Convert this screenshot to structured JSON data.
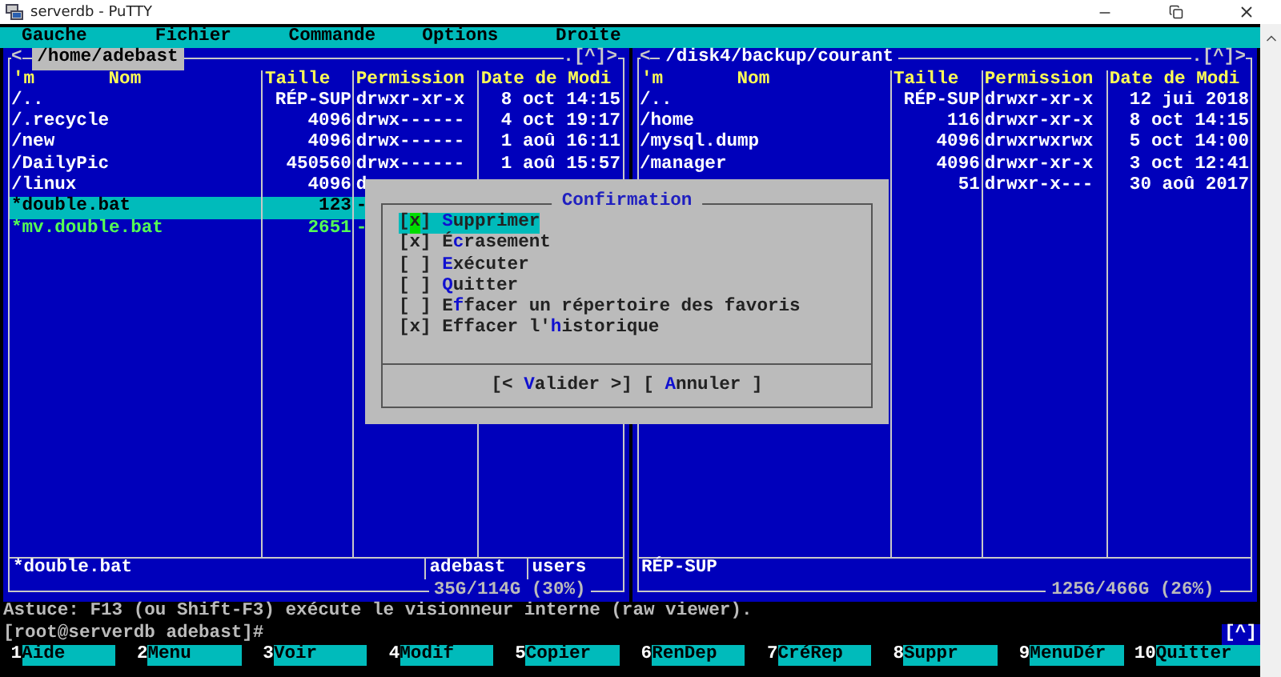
{
  "window": {
    "title": "serverdb - PuTTY"
  },
  "menu": [
    "Gauche",
    "Fichier",
    "Commande",
    "Options",
    "Droite"
  ],
  "panels": [
    {
      "active": true,
      "nav_left": "<",
      "path": "/home/adebast",
      "nav_right": ".[^]>",
      "sort_mark": "'m",
      "columns": [
        "Nom",
        "Taille",
        "Permission",
        "Date de Modi"
      ],
      "rows": [
        {
          "name": "/..",
          "size": "RÉP-SUP",
          "permission": "drwxr-xr-x",
          "date": "8 oct 14:15",
          "kind": "dir",
          "selected": false
        },
        {
          "name": "/.recycle",
          "size": "4096",
          "permission": "drwx------",
          "date": "4 oct 19:17",
          "kind": "dir",
          "selected": false
        },
        {
          "name": "/new",
          "size": "4096",
          "permission": "drwx------",
          "date": "1 aoû 16:11",
          "kind": "dir",
          "selected": false
        },
        {
          "name": "/DailyPic",
          "size": "450560",
          "permission": "drwx------",
          "date": "1 aoû 15:57",
          "kind": "dir",
          "selected": false
        },
        {
          "name": "/linux",
          "size": "4096",
          "permission": "d",
          "kind": "dir",
          "selected": false
        },
        {
          "name": "*double.bat",
          "size": "123",
          "permission": "-",
          "kind": "exec",
          "selected": true
        },
        {
          "name": "*mv.double.bat",
          "size": "2651",
          "permission": "-",
          "kind": "exec",
          "selected": false
        }
      ],
      "status": [
        "*double.bat",
        "adebast",
        "users"
      ],
      "disk": "35G/114G (30%)"
    },
    {
      "active": false,
      "nav_left": "<",
      "path": "/disk4/backup/courant",
      "nav_right": ".[^]>",
      "sort_mark": "'m",
      "columns": [
        "Nom",
        "Taille",
        "Permission",
        "Date de Modi"
      ],
      "rows": [
        {
          "name": "/..",
          "size": "RÉP-SUP",
          "permission": "drwxr-xr-x",
          "date": "12 jui 2018",
          "kind": "dir",
          "selected": false
        },
        {
          "name": "/home",
          "size": "116",
          "permission": "drwxr-xr-x",
          "date": "8 oct 14:15",
          "kind": "dir",
          "selected": false
        },
        {
          "name": "/mysql.dump",
          "size": "4096",
          "permission": "drwxrwxrwx",
          "date": "5 oct 14:00",
          "kind": "dir",
          "selected": false
        },
        {
          "name": "/manager",
          "size": "4096",
          "permission": "drwxr-xr-x",
          "date": "3 oct 12:41",
          "kind": "dir",
          "selected": false
        },
        {
          "size": "51",
          "permission": "drwxr-x---",
          "date": "30 aoû 2017",
          "kind": "dir",
          "selected": false
        }
      ],
      "status": [
        "RÉP-SUP"
      ],
      "disk": "125G/466G (26%)"
    }
  ],
  "dialog": {
    "title": "Confirmation",
    "options": [
      {
        "box": "[x]",
        "selected": true,
        "parts": [
          {
            "text": "S",
            "hotkey": true
          },
          {
            "text": "upprimer",
            "hotkey": false
          }
        ]
      },
      {
        "box": "[x]",
        "selected": false,
        "parts": [
          {
            "text": "É",
            "hotkey": false
          },
          {
            "text": "c",
            "hotkey": true
          },
          {
            "text": "rasement",
            "hotkey": false
          }
        ]
      },
      {
        "box": "[ ]",
        "selected": false,
        "parts": [
          {
            "text": "E",
            "hotkey": true
          },
          {
            "text": "xécuter",
            "hotkey": false
          }
        ]
      },
      {
        "box": "[ ]",
        "selected": false,
        "parts": [
          {
            "text": "Q",
            "hotkey": true
          },
          {
            "text": "uitter",
            "hotkey": false
          }
        ]
      },
      {
        "box": "[ ]",
        "selected": false,
        "parts": [
          {
            "text": "E",
            "hotkey": false
          },
          {
            "text": "f",
            "hotkey": true
          },
          {
            "text": "facer un répertoire des favoris",
            "hotkey": false
          }
        ]
      },
      {
        "box": "[x]",
        "selected": false,
        "parts": [
          {
            "text": "Effacer l'",
            "hotkey": false
          },
          {
            "text": "h",
            "hotkey": true
          },
          {
            "text": "istorique",
            "hotkey": false
          }
        ]
      }
    ],
    "buttons": [
      {
        "parts": [
          {
            "text": "[< ",
            "hotkey": false
          },
          {
            "text": "V",
            "hotkey": true
          },
          {
            "text": "alider >]",
            "hotkey": false
          }
        ]
      },
      {
        "parts": [
          {
            "text": "[ ",
            "hotkey": false
          },
          {
            "text": "A",
            "hotkey": true
          },
          {
            "text": "nnuler ]",
            "hotkey": false
          }
        ]
      }
    ]
  },
  "hint": "Astuce: F13 (ou Shift-F3) exécute le visionneur interne (raw viewer).",
  "prompt": "[root@serverdb adebast]#",
  "prompt_indicator": "[^]",
  "function_keys": [
    {
      "number": "1",
      "label": "Aide"
    },
    {
      "number": "2",
      "label": "Menu"
    },
    {
      "number": "3",
      "label": "Voir"
    },
    {
      "number": "4",
      "label": "Modif"
    },
    {
      "number": "5",
      "label": "Copier"
    },
    {
      "number": "6",
      "label": "RenDep"
    },
    {
      "number": "7",
      "label": "CréRep"
    },
    {
      "number": "8",
      "label": "Suppr"
    },
    {
      "number": "9",
      "label": "MenuDér"
    },
    {
      "number": "10",
      "label": "Quitter"
    }
  ]
}
